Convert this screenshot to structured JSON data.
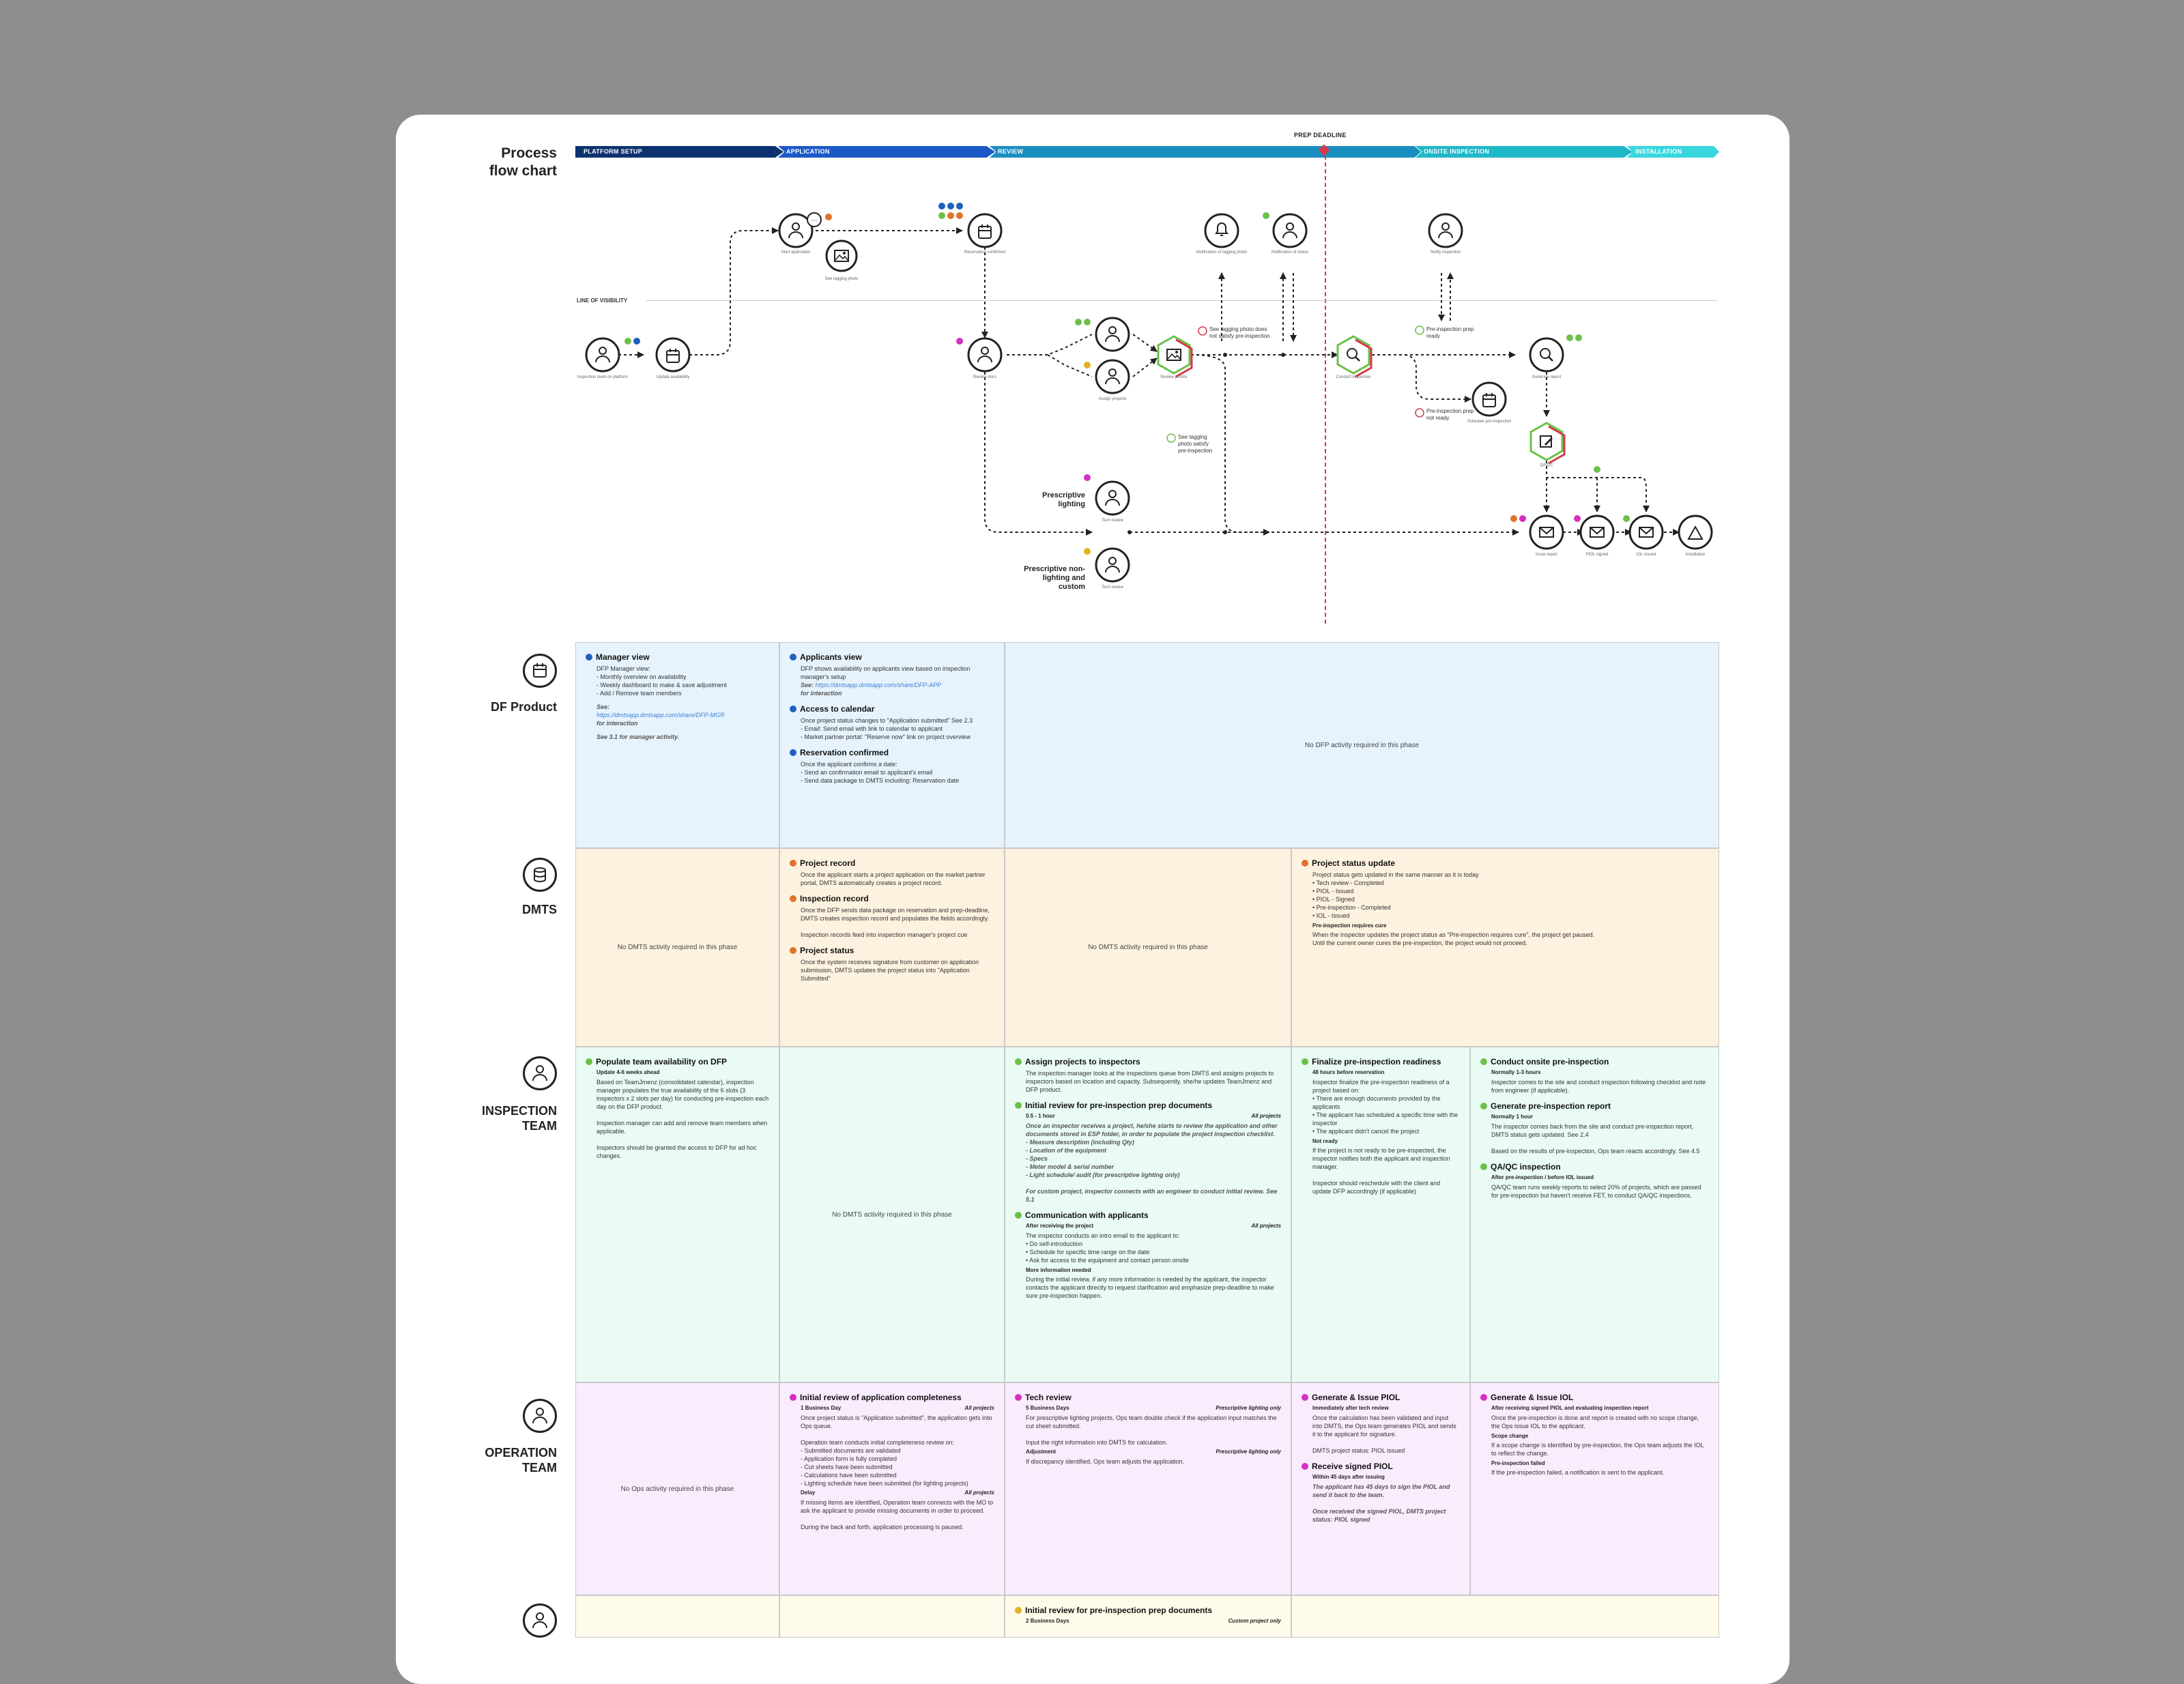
{
  "header": {
    "title_line1": "Process",
    "title_line2": "flow chart",
    "phases": [
      "PLATFORM SETUP",
      "APPLICATION",
      "REVIEW",
      "ONSITE INSPECTION",
      "INSTALLATION"
    ],
    "prep_deadline": "PREP DEADLINE",
    "line_of_visibility": "LINE OF VISIBILITY"
  },
  "colors": {
    "phase1": "#0d3270",
    "phase2": "#1b59c7",
    "phase3": "#1b8ec0",
    "phase4": "#1fb8c8",
    "phase5": "#38d6df",
    "deadline": "#d33a4a"
  },
  "flow": {
    "captions": {
      "n1": "Inspection team on platform",
      "n2": "Update availability",
      "n3": "Start application",
      "n4": "See tagging photo",
      "n5": "Reservation confirmed",
      "n6": "Notification of tagging photo",
      "n7": "Notification of status",
      "n8": "Notify inspection",
      "n9": "Review docs",
      "n10": "Assign projects",
      "n11": "Review photos",
      "n12": "Conduct inspection",
      "n13": "Schedule pre-inspection",
      "n14": "Generate report",
      "n15": "QA/QC",
      "n16": "Issue report",
      "n17": "PIOL signed",
      "n18": "IOL issued",
      "n19": "Installation",
      "n20": "Tech review",
      "n21": "Tech review"
    },
    "annotations": {
      "a1": "See tagging photo does not satisfy pre-inspection",
      "a2": "See tagging photo satisfy pre-inspection",
      "a3": "Pre-inspection prep ready",
      "a4": "Pre-inspection prep not ready",
      "prescriptive_lighting": "Prescriptive lighting",
      "prescriptive_nonlighting": "Prescriptive non-lighting and custom"
    }
  },
  "lanes": {
    "df_product": {
      "title": "DF Product",
      "icon": "calendar-icon",
      "cell1": {
        "heading": "Manager view",
        "body": "DFP Manager view:\n- Monthly overview on availability\n- Weekly dashboard to make & save adjustment\n- Add / Remove team members",
        "see_label": "See:",
        "link": "https://dmtsapp.dmtsapp.com/share/DFP-MGR",
        "see_note": "for interaction",
        "see_more": "See 3.1 for manager activity."
      },
      "cell2": {
        "s1_heading": "Applicants view",
        "s1_body": "DFP shows availability on applicants view based on inspection manager's setup",
        "s1_see": "See:",
        "s1_link": "https://dmtsapp.dmtsapp.com/share/DFP-APP",
        "s1_note": "for interaction",
        "s2_heading": "Access to calendar",
        "s2_body": "Once project status changes to \"Application submitted\" See 2.3\n- Email: Send email with link to calendar to applicant\n- Market partner portal: \"Reserve now\" link on project overview",
        "s3_heading": "Reservation confirmed",
        "s3_body": "Once the applicant confirms a date:\n- Send an confirmation email to applicant's email\n- Send data package to DMTS including: Reservation date"
      },
      "cell3": "No DFP activity required in this phase"
    },
    "dmts": {
      "title": "DMTS",
      "icon": "database-icon",
      "cell1": "No DMTS activity required in this phase",
      "cell2": {
        "s1_heading": "Project record",
        "s1_body": "Once the applicant starts a project application on the market partner portal, DMTS automatically creates a project record.",
        "s2_heading": "Inspection record",
        "s2_body": "Once the DFP sends data package on reservation and prep-deadline, DMTS creates inspection record and populates the fields accordingly.\n\nInspection records feed into inspection manager's project cue",
        "s3_heading": "Project status",
        "s3_body": "Once the system receives signature from customer on application submission, DMTS updates the project status into \"Application Submitted\""
      },
      "cell3": "No DMTS activity required in this phase",
      "cell4": {
        "heading": "Project status update",
        "body": "Project status gets updated in the same manner as it is today\n• Tech review - Completed\n• PIOL - Issued\n• PIOL - Signed\n• Pre-inspection - Completed\n• IOL - Issued",
        "flag": "Pre-inspection requires cure",
        "flag_body": "When the inspector updates the project status as \"Pre-inspection requires cure\", the project get paused.\nUntil the current owner cures the pre-inspection, the project would not proceed."
      }
    },
    "inspection": {
      "title_line1": "INSPECTION",
      "title_line2": "TEAM",
      "icon": "inspector-icon",
      "cell1": {
        "heading": "Populate team availability on DFP",
        "meta": "Update 4-6 weeks ahead",
        "body": "Based on TeamJmenz (consolidated calendar), inspection manager populates the true availability of the 6 slots (3 inspectors x 2 slots per day) for conducting pre-inspection each day on the DFP product.\n\nInspection manager can add and remove team members when applicable.\n\nInspectors should be granted the access to DFP for ad hoc changes."
      },
      "cell2": "No DMTS activity required in this phase",
      "cell3": {
        "s1_heading": "Assign projects to inspectors",
        "s1_body": "The inspection manager looks at the inspections queue from DMTS and assigns projects to inspectors based on location and capacity. Subsequently, she/he updates TeamJmenz and DFP product.",
        "s2_heading": "Initial review for pre-inspection prep documents",
        "s2_meta_left": "0.5 - 1 hour",
        "s2_meta_right": "All projects",
        "s2_body": "Once an inspector receives a project, he/she starts to review the application and other documents stored in ESP folder, in order to populate the project inspection checklist.\n- Measure description (including Qty)\n- Location of the equipment\n- Specs\n- Meter model & serial number\n- Light schedule/ audit (for prescriptive lighting only)\n\nFor custom project, inspector connects with an engineer to conduct initial review. See 5.1",
        "s3_heading": "Communication with applicants",
        "s3_meta_left": "After receiving the project",
        "s3_meta_right": "All projects",
        "s3_body": "The inspector conducts an intro email to the applicant to:\n• Do self-introduction\n• Schedule for specific time range on the date\n• Ask for access to the equipment and contact person onsite",
        "s3_flag": "More information needed",
        "s3_flag_body": "During the initial review, if any more information is needed by the applicant, the inspector contacts the applicant directly to request clarification and emphasize prep-deadline to make sure pre-inspection happen."
      },
      "cell4": {
        "heading": "Finalize pre-inspection readiness",
        "meta": "48 hours before reservation",
        "body": "Inspector finalize the pre-inspection readiness of a project based on:\n• There are enough documents provided by the applicants\n• The applicant has scheduled a specific time with the inspector\n• The applicant didn't cancel the project",
        "flag": "Not ready",
        "flag_body": "If the project is not ready to be pre-inspected, the inspector notifies both the applicant and inspection manager.\n\nInspector should reschedule with the client and update DFP accordingly (if applicable)"
      },
      "cell5": {
        "s1_heading": "Conduct onsite pre-inspection",
        "s1_meta": "Normally 1-3 hours",
        "s1_body": "Inspector comes to the site and conduct inspection following checklist and note from engineer (if applicable).",
        "s2_heading": "Generate pre-inspection report",
        "s2_meta": "Normally 1 hour",
        "s2_body": "The inspector comes back from the site and conduct pre-inspection report, DMTS status gets updated. See 2.4\n\nBased on the results of pre-inspection, Ops team reacts accordingly. See 4.5",
        "s3_heading": "QA/QC inspection",
        "s3_meta": "After pre-inspection / before IOL issued",
        "s3_body": "QA/QC team runs weekly reports to select 20% of projects, which are passed for pre-inspection but haven't receive FET, to conduct QA/QC inspections."
      }
    },
    "operation": {
      "title_line1": "OPERATION",
      "title_line2": "TEAM",
      "icon": "operator-icon",
      "cell1": "No Ops activity required in this phase",
      "cell2": {
        "heading": "Initial review of application completeness",
        "meta_left": "1 Business Day",
        "meta_right": "All projects",
        "body": "Once project status is \"Application submitted\", the application gets into Ops queue.\n\nOperation team conducts initial completeness review on:\n- Submitted documents are validated\n- Application form is fully completed\n- Cut sheets have been submitted\n- Calculations have been submitted\n- Lighting schedule have been submitted (for lighting projects)",
        "flag": "Delay",
        "flag_right": "All projects",
        "flag_body": "If missing items are identified, Operation team connects with the MO to ask the applicant to provide missing documents in order to proceed.\n\nDuring the back and forth, application processing is paused."
      },
      "cell3": {
        "heading": "Tech review",
        "meta_left": "5 Business Days",
        "meta_right": "Prescriptive lighting only",
        "body": "For prescriptive lighting projects, Ops team double check if the application input matches the cut sheet submitted.\n\nInput the right information into DMTS for calculation.",
        "flag": "Adjustment",
        "flag_right": "Prescriptive lighting only",
        "flag_body": "If discrepancy identified, Ops team adjusts the application."
      },
      "cell4": {
        "s1_heading": "Generate & Issue PIOL",
        "s1_meta": "Immediately after tech review",
        "s1_body": "Once the calculation has been validated and input into DMTS, the Ops team generates PIOL and sends it to the applicant for signature.\n\nDMTS project status: PIOL issued",
        "s2_heading": "Receive signed PIOL",
        "s2_meta": "Within 45 days after issuing",
        "s2_body": "The applicant has 45 days to sign the PIOL and send it back to the team.\n\nOnce received the signed PIOL, DMTS project status: PIOL signed"
      },
      "cell5": {
        "heading": "Generate & Issue IOL",
        "meta": "After receiving signed PIOL and evaluating inspection report",
        "body": "Once the pre-inspection is done and report is created with no scope change, the Ops issue IOL to the applicant.",
        "flag1": "Scope change",
        "flag1_body": "If a scope change is identified by pre-inspection, the Ops team adjusts the IOL to reflect the change.",
        "flag2": "Pre-inspection failed",
        "flag2_body": "If the pre-inspection failed, a notification is sent to the applicant."
      }
    },
    "fifth": {
      "icon": "engineer-icon",
      "heading": "Initial review for pre-inspection prep documents",
      "meta_left": "2 Business Days",
      "meta_right": "Custom project only"
    }
  }
}
